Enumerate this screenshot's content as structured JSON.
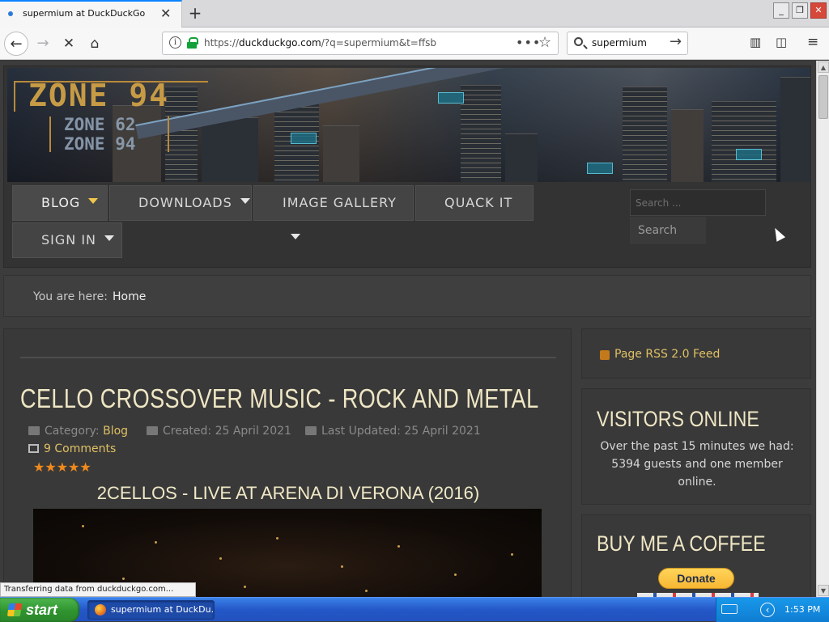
{
  "browser": {
    "tab_title": "supermium at DuckDuckGo",
    "tab_close": "✕",
    "new_tab": "+",
    "url_prefix": "https://",
    "url_host": "duckduckgo.com",
    "url_rest": "/?q=supermium&t=ffsb",
    "search_query": "supermium",
    "url_menu": "•••",
    "status_text": "Transferring data from duckduckgo.com..."
  },
  "site": {
    "logo_main": "ZONE 94",
    "logo_sub1": "ZONE 62",
    "logo_sub2": "ZONE 94",
    "menu": [
      {
        "label": "BLOG"
      },
      {
        "label": "DOWNLOADS"
      },
      {
        "label": "IMAGE GALLERY"
      },
      {
        "label": "QUACK IT"
      },
      {
        "label": "SIGN IN"
      }
    ],
    "search_placeholder": "Search ...",
    "search_button": "Search",
    "breadcrumb_label": "You are here:",
    "breadcrumb_home": "Home"
  },
  "article": {
    "title": "CELLO CROSSOVER MUSIC - ROCK AND METAL",
    "category_label": "Category:",
    "category_value": "Blog",
    "created": "Created: 25 April 2021",
    "updated": "Last Updated: 25 April 2021",
    "comments": "9 Comments",
    "stars": "★★★★★",
    "subtitle": "2CELLOS - LIVE AT ARENA DI VERONA (2016)"
  },
  "sidebar": {
    "rss": "Page RSS 2.0 Feed",
    "visitors_title": "VISITORS ONLINE",
    "visitors_text": "Over the past 15 minutes we had: 5394 guests and one member online.",
    "coffee_title": "BUY ME A COFFEE",
    "donate_label": "Donate"
  },
  "taskbar": {
    "start_label": "start",
    "task_item": "supermium at DuckDu...",
    "clock": "1:53 PM"
  }
}
